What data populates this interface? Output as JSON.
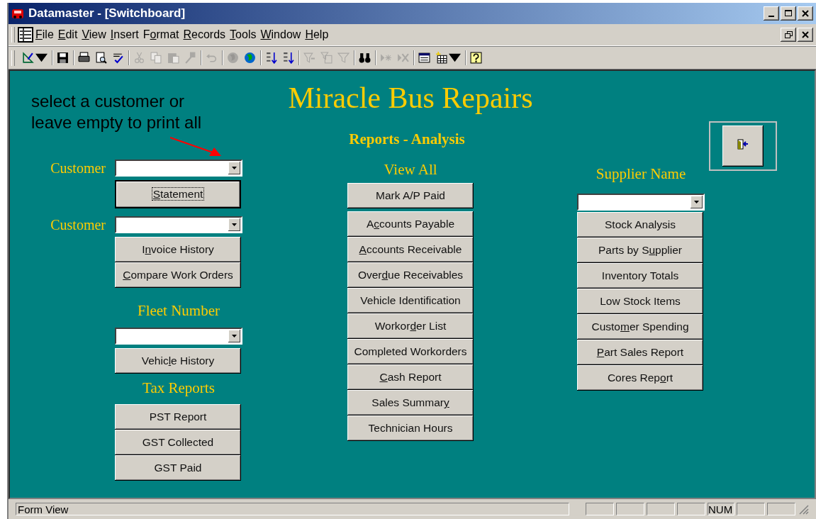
{
  "window": {
    "title": "Datamaster - [Switchboard]"
  },
  "menu": [
    {
      "key": "F",
      "after": "ile"
    },
    {
      "key": "E",
      "after": "dit"
    },
    {
      "key": "V",
      "after": "iew"
    },
    {
      "key": "I",
      "after": "nsert"
    },
    {
      "before": "F",
      "key": "o",
      "after": "rmat"
    },
    {
      "key": "R",
      "after": "ecords"
    },
    {
      "key": "T",
      "after": "ools"
    },
    {
      "key": "W",
      "after": "indow"
    },
    {
      "key": "H",
      "after": "elp"
    }
  ],
  "toolbar": {
    "groups": [
      [
        {
          "disabled": false
        }
      ],
      [
        {
          "disabled": false
        }
      ],
      [
        {
          "disabled": false
        },
        {
          "disabled": false
        },
        {
          "disabled": false
        }
      ],
      [
        {
          "disabled": true
        },
        {
          "disabled": true
        },
        {
          "disabled": true
        },
        {
          "disabled": true
        }
      ],
      [
        {
          "disabled": true
        }
      ],
      [
        {
          "disabled": true
        },
        {
          "disabled": false
        }
      ],
      [
        {
          "disabled": false
        },
        {
          "disabled": false
        }
      ],
      [
        {
          "disabled": true
        },
        {
          "disabled": true
        },
        {
          "disabled": true
        }
      ],
      [
        {
          "disabled": false
        }
      ],
      [
        {
          "disabled": true
        },
        {
          "disabled": true
        }
      ],
      [
        {
          "disabled": false
        },
        {
          "disabled": false
        }
      ],
      [
        {
          "disabled": false
        }
      ]
    ]
  },
  "form": {
    "title": "Miracle Bus Repairs",
    "subtitle": "Reports - Analysis",
    "instruction": "select a customer or leave empty to print all",
    "left": [
      {
        "kind": "combo",
        "label": "Customer"
      },
      {
        "kind": "button",
        "focused": true,
        "key": "S",
        "after": "tatement"
      },
      {
        "kind": "combo",
        "label": "Customer"
      },
      {
        "kind": "button",
        "focused": false,
        "before": "I",
        "key": "n",
        "after": "voice History"
      },
      {
        "kind": "button",
        "focused": false,
        "key": "C",
        "after": "ompare Work Orders"
      },
      {
        "kind": "heading",
        "label": "Fleet Number"
      },
      {
        "kind": "combo"
      },
      {
        "kind": "button",
        "focused": false,
        "before": "Vehic",
        "key": "l",
        "after": "e History"
      },
      {
        "kind": "heading",
        "label": "Tax Reports"
      },
      {
        "kind": "button",
        "focused": false,
        "before": "PST Report"
      },
      {
        "kind": "button",
        "focused": false,
        "before": "GST Collected"
      },
      {
        "kind": "button",
        "focused": false,
        "before": "GST Paid"
      }
    ],
    "middle": {
      "heading": "View All",
      "buttons": [
        {
          "focused": false,
          "before": "Mark A/P  Paid"
        },
        {
          "focused": false,
          "before": "A",
          "key": "c",
          "after": "counts Payable"
        },
        {
          "focused": false,
          "key": "A",
          "after": "ccounts  Receivable"
        },
        {
          "focused": false,
          "before": "Over",
          "key": "d",
          "after": "ue Receivables"
        },
        {
          "focused": false,
          "before": "Vehicle Identification"
        },
        {
          "focused": false,
          "before": "Workor",
          "key": "d",
          "after": "er List"
        },
        {
          "focused": false,
          "before": "Completed Workorders"
        },
        {
          "focused": false,
          "key": "C",
          "after": "ash Report"
        },
        {
          "focused": false,
          "before": "Sales Summar",
          "key": "y"
        },
        {
          "focused": false,
          "before": "Technician Hours"
        }
      ]
    },
    "right": {
      "heading": "Supplier Name",
      "buttons": [
        {
          "focused": false,
          "before": "Stock Analysis"
        },
        {
          "focused": false,
          "before": "Parts by S",
          "key": "u",
          "after": "pplier"
        },
        {
          "focused": false,
          "before": "Inventory Totals"
        },
        {
          "focused": false,
          "before": "Low Stock Items"
        },
        {
          "focused": false,
          "before": "Custo",
          "key": "m",
          "after": "er Spending"
        },
        {
          "focused": false,
          "key": "P",
          "after": "art Sales Report"
        },
        {
          "focused": false,
          "before": "Cores Rep",
          "key": "o",
          "after": "rt"
        }
      ]
    }
  },
  "status_bar": {
    "message": "Form View",
    "indicator": "NUM"
  }
}
